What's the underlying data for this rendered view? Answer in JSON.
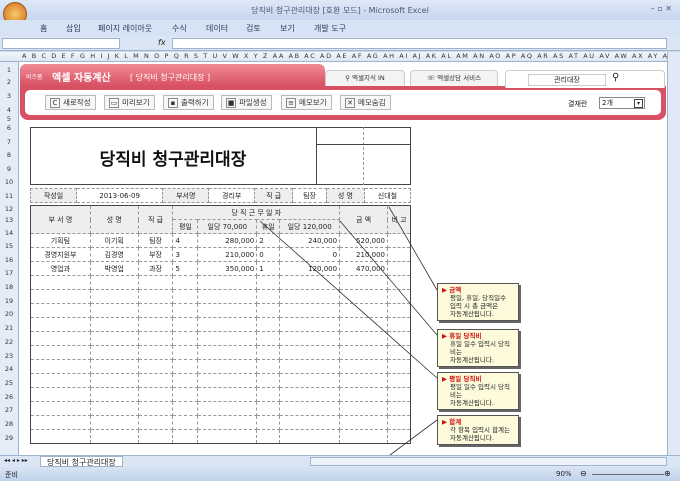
{
  "window": {
    "title": "당직비 청구관리대장  [호환 모드] - Microsoft Excel"
  },
  "ribbon_tabs": [
    "홈",
    "삽입",
    "페이지 레이아웃",
    "수식",
    "데이터",
    "검토",
    "보기",
    "개발 도구"
  ],
  "formula_bar": {
    "fx": "fx",
    "name_box": ""
  },
  "columns": "A B C D E F G H I J K L M N O P Q R S T U V W X Y Z AA AB AC AD AE AF AG AH AI AJ AK AL AM AN AO AP AQ AR AS AT AU AV AW AX AY AZ BB BC BE",
  "rows": [
    "1",
    "2",
    "3",
    "4",
    "5",
    "6",
    "7",
    "8",
    "9",
    "10",
    "11",
    "12",
    "13",
    "14",
    "15",
    "16",
    "17",
    "18",
    "19",
    "20",
    "21",
    "22",
    "23",
    "24",
    "25",
    "26",
    "27",
    "28",
    "29"
  ],
  "banner": {
    "brand_small": "비즈폼",
    "brand": "엑셀 자동계산",
    "subtitle": "[ 당직비 청구관리대장 ]",
    "tab1": "엑셀지식 IN",
    "tab2": "엑셀상담 서비스",
    "search": "관리대장",
    "buttons": [
      "새로작성",
      "미리보기",
      "출력하기",
      "파일생성",
      "메모보기",
      "메모숨김"
    ],
    "approval_label": "결재란",
    "approval_value": "2개"
  },
  "doc": {
    "title": "당직비 청구관리대장",
    "info": {
      "date_label": "작성일",
      "date": "2013-06-09",
      "dept_label": "부서명",
      "dept": "경리부",
      "rank_label": "직 급",
      "rank": "팀장",
      "name_label": "성 명",
      "name": "신대철"
    },
    "headers": {
      "dept": "부 서 명",
      "name": "성  명",
      "rank": "직 급",
      "duty": "당 직 근 무 일 자",
      "weekday": "평일",
      "weekday_rate": "일당 70,000",
      "holiday": "휴일",
      "holiday_rate": "일당 120,000",
      "amount": "금  액",
      "note": "비 고"
    },
    "rows": [
      {
        "dept": "기획팀",
        "name": "이기획",
        "rank": "팀장",
        "wd": "4",
        "wd_amt": "280,000",
        "hd": "2",
        "hd_amt": "240,000",
        "amount": "520,000"
      },
      {
        "dept": "경영지원부",
        "name": "김경영",
        "rank": "부장",
        "wd": "3",
        "wd_amt": "210,000",
        "hd": "0",
        "hd_amt": "0",
        "amount": "210,000"
      },
      {
        "dept": "영업과",
        "name": "박영업",
        "rank": "과장",
        "wd": "5",
        "wd_amt": "350,000",
        "hd": "1",
        "hd_amt": "120,000",
        "amount": "470,000"
      }
    ]
  },
  "callouts": [
    {
      "title": "금액",
      "text": [
        "평일, 휴일, 당직일수",
        "입력 시 총 금액은",
        "자동계산됩니다."
      ]
    },
    {
      "title": "휴일 당직비",
      "text": [
        "휴일 일수 입력시 당직비는",
        "자동계산됩니다."
      ]
    },
    {
      "title": "평일 당직비",
      "text": [
        "평일 일수 입력시 당직비는",
        "자동계산됩니다."
      ]
    },
    {
      "title": "합계",
      "text": [
        "각 항목 입력시 합계는",
        "자동계산됩니다."
      ]
    }
  ],
  "sheet_tab": "당직비 청구관리대장",
  "status": {
    "ready": "준비",
    "zoom": "90%"
  }
}
